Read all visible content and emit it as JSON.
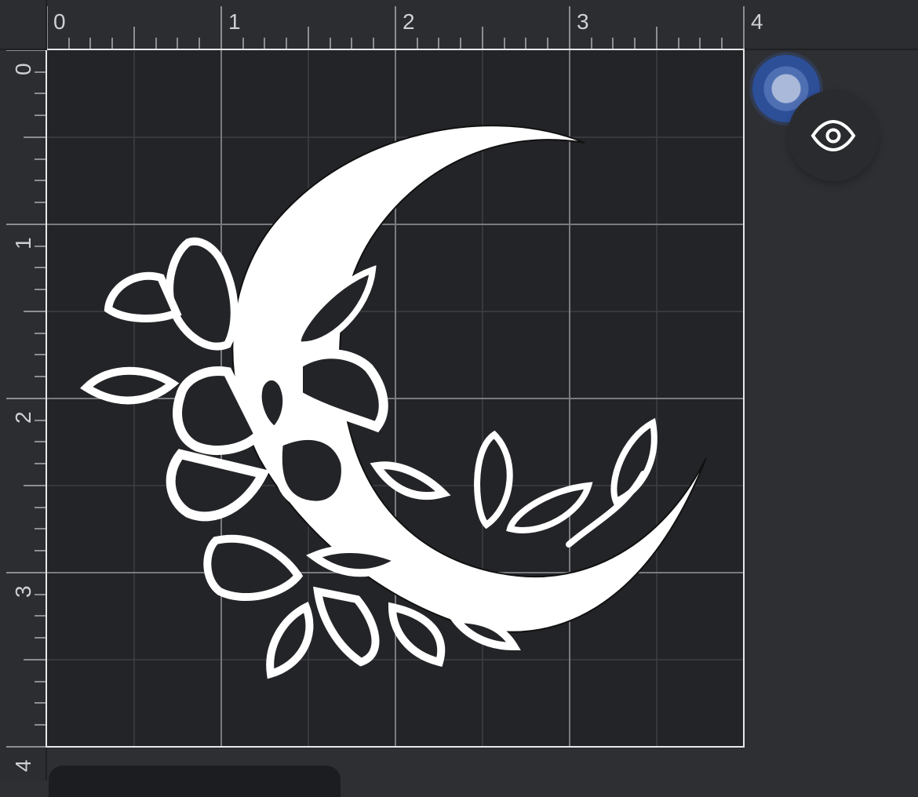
{
  "ruler": {
    "horizontal_labels": [
      "0",
      "1",
      "2",
      "3",
      "4"
    ],
    "vertical_labels": [
      "0",
      "1",
      "2",
      "3",
      "4"
    ]
  },
  "colors": {
    "background": "#2e2f33",
    "mat": "#232427",
    "grid": "#3a3b40",
    "design": "#ffffff",
    "handle": "#3a5eaa"
  },
  "icons": {
    "visibility": "eye-icon"
  }
}
